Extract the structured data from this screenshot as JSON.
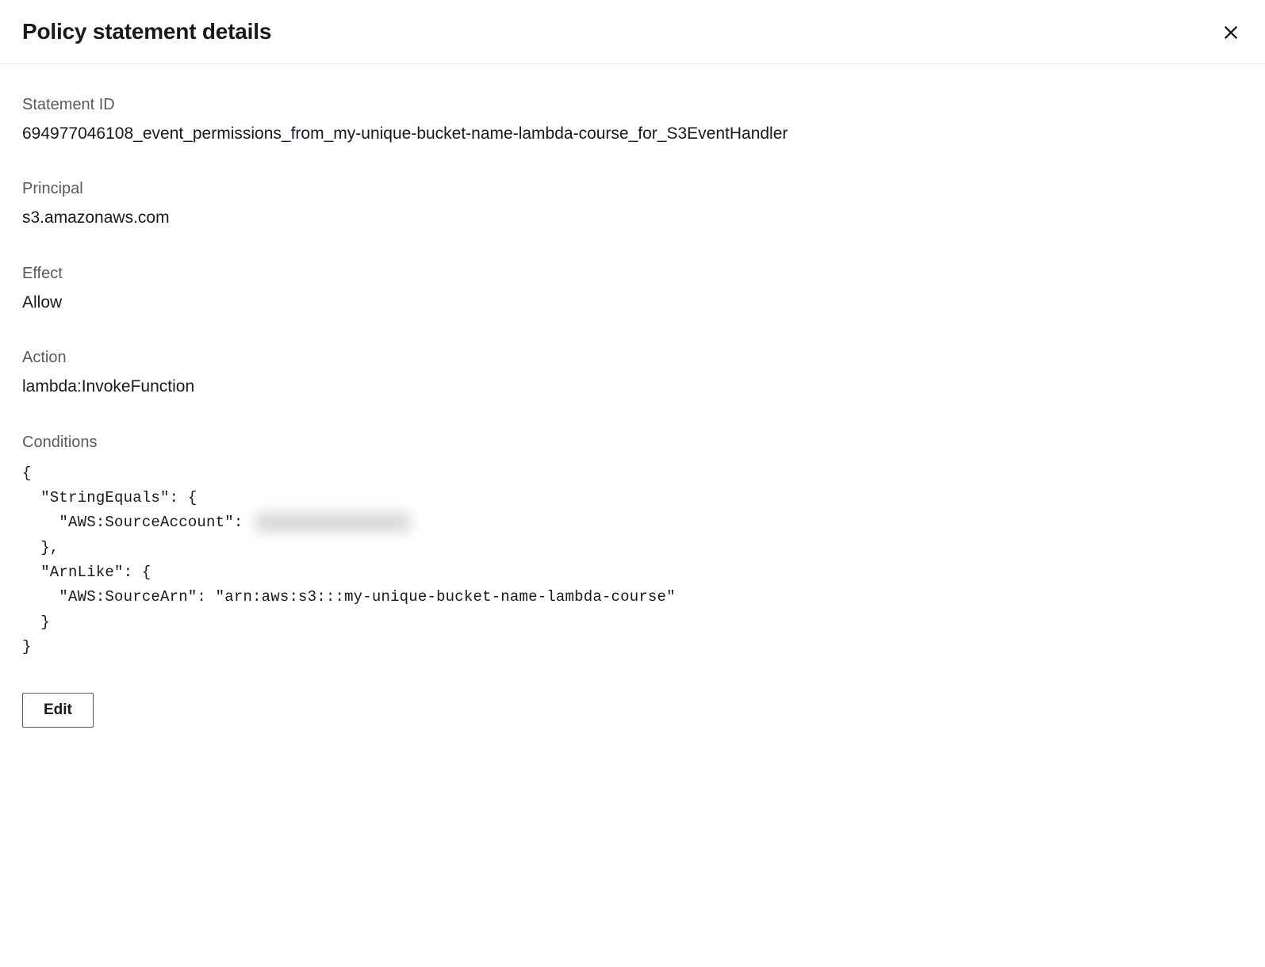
{
  "modal": {
    "title": "Policy statement details",
    "closeLabel": "Close"
  },
  "fields": {
    "statementId": {
      "label": "Statement ID",
      "value": "694977046108_event_permissions_from_my-unique-bucket-name-lambda-course_for_S3EventHandler"
    },
    "principal": {
      "label": "Principal",
      "value": "s3.amazonaws.com"
    },
    "effect": {
      "label": "Effect",
      "value": "Allow"
    },
    "action": {
      "label": "Action",
      "value": "lambda:InvokeFunction"
    },
    "conditions": {
      "label": "Conditions",
      "code": {
        "line1": "{",
        "line2": "  \"StringEquals\": {",
        "line3a": "    \"AWS:SourceAccount\": ",
        "line4": "  },",
        "line5": "  \"ArnLike\": {",
        "line6": "    \"AWS:SourceArn\": \"arn:aws:s3:::my-unique-bucket-name-lambda-course\"",
        "line7": "  }",
        "line8": "}"
      }
    }
  },
  "actions": {
    "editLabel": "Edit"
  }
}
